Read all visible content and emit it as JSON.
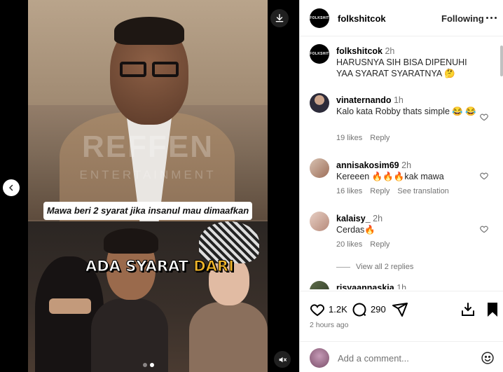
{
  "media": {
    "caption_box": "Mawa beri 2 syarat jika insanul mau dimaafkan",
    "watermark": "REFFEN",
    "watermark_sub": "ENTERTAINMENT",
    "overlay_text_main": "ADA SYARAT ",
    "overlay_text_highlight": "DARI",
    "carousel_count": 2,
    "carousel_active": 2
  },
  "header": {
    "avatar_text": "FOLKSHIT",
    "username": "folkshitcok",
    "follow_state": "Following"
  },
  "caption": {
    "username": "folkshitcok",
    "time": "2h",
    "text": "HARUSNYA SIH BISA DIPENUHI YAA SYARAT SYARATNYA 🤔"
  },
  "comments": [
    {
      "username": "vinaternando",
      "time": "1h",
      "text": "Kalo kata Robby thats simple 😂 😂",
      "likes": "19 likes",
      "reply": "Reply",
      "translate": ""
    },
    {
      "username": "annisakosim69",
      "time": "2h",
      "text": "Kereeen 🔥🔥🔥kak mawa",
      "likes": "16 likes",
      "reply": "Reply",
      "translate": "See translation"
    },
    {
      "username": "kalaisy_",
      "time": "2h",
      "text": "Cerdas🔥",
      "likes": "20 likes",
      "reply": "Reply",
      "translate": ""
    },
    {
      "username": "risyaannaskia",
      "time": "1h",
      "text": "",
      "likes": "",
      "reply": "",
      "translate": ""
    }
  ],
  "view_replies": "View all 2 replies",
  "actions": {
    "like_count": "1.2K",
    "comment_count": "290",
    "posted": "2 hours ago"
  },
  "add_comment": {
    "placeholder": "Add a comment..."
  },
  "icons": {
    "download": "download-icon",
    "prev": "chevron-left-icon",
    "mute": "speaker-muted-icon",
    "heart": "heart-icon",
    "comment": "comment-bubble-icon",
    "share": "paper-plane-icon",
    "save": "bookmark-icon",
    "emoji": "smiley-icon"
  },
  "colors": {
    "meta_gray": "#737373",
    "text": "#262626",
    "border": "#dbdbdb"
  }
}
